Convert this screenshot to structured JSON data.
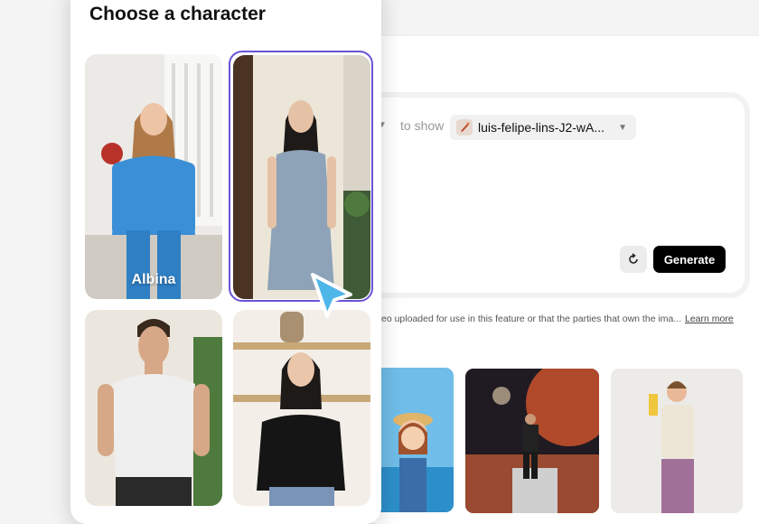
{
  "picker": {
    "title": "Choose a character",
    "characters": [
      {
        "name": "Albina",
        "selected": false
      },
      {
        "name": "",
        "selected": true
      },
      {
        "name": "",
        "selected": false
      },
      {
        "name": "",
        "selected": false
      }
    ]
  },
  "prompt": {
    "to_show_label": "to show",
    "video_name": "luis-felipe-lins-J2-wA...",
    "generate_label": "Generate"
  },
  "disclaimer": {
    "text": "eo uploaded for use in this feature or that the parties that own the ima...",
    "learn_more": "Learn more"
  },
  "colors": {
    "accent_purple": "#6a52d6",
    "cursor_blue": "#4fb6e8",
    "generate_bg": "#000000"
  }
}
